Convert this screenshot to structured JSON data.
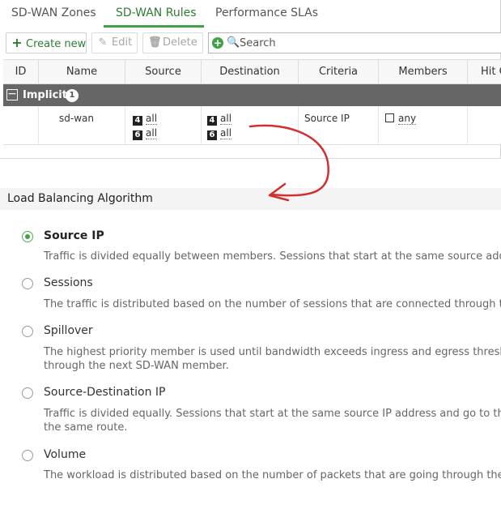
{
  "tabs": [
    {
      "label": "SD-WAN Zones",
      "active": false
    },
    {
      "label": "SD-WAN Rules",
      "active": true
    },
    {
      "label": "Performance SLAs",
      "active": false
    }
  ],
  "toolbar": {
    "create_label": "Create new",
    "edit_label": "Edit",
    "delete_label": "Delete",
    "search_placeholder": "Search"
  },
  "table": {
    "columns": [
      "ID",
      "Name",
      "Source",
      "Destination",
      "Criteria",
      "Members",
      "Hit C"
    ],
    "group": {
      "label": "Implicit",
      "count": "1"
    },
    "row": {
      "id": "",
      "name": "sd-wan",
      "source": [
        {
          "badge": "4",
          "value": "all"
        },
        {
          "badge": "6",
          "value": "all"
        }
      ],
      "destination": [
        {
          "badge": "4",
          "value": "all"
        },
        {
          "badge": "6",
          "value": "all"
        }
      ],
      "criteria": "Source IP",
      "members": "any"
    }
  },
  "lb": {
    "title": "Load Balancing Algorithm",
    "options": [
      {
        "label": "Source IP",
        "selected": true,
        "desc": [
          "Traffic is divided equally between members. Sessions that start at the same source addr"
        ]
      },
      {
        "label": "Sessions",
        "selected": false,
        "desc": [
          "The traffic is distributed based on the number of sessions that are connected through th"
        ]
      },
      {
        "label": "Spillover",
        "selected": false,
        "desc": [
          "The highest priority member is used until bandwidth exceeds ingress and egress thresho",
          "through the next SD-WAN member."
        ]
      },
      {
        "label": "Source-Destination IP",
        "selected": false,
        "desc": [
          "Traffic is divided equally. Sessions that start at the same source IP address and go to the",
          "the same route."
        ]
      },
      {
        "label": "Volume",
        "selected": false,
        "desc": [
          "The workload is distributed based on the number of packets that are going through the"
        ]
      }
    ]
  },
  "colors": {
    "accent": "#43a047",
    "group_bg": "#666666",
    "annotation": "#d32f2f"
  }
}
